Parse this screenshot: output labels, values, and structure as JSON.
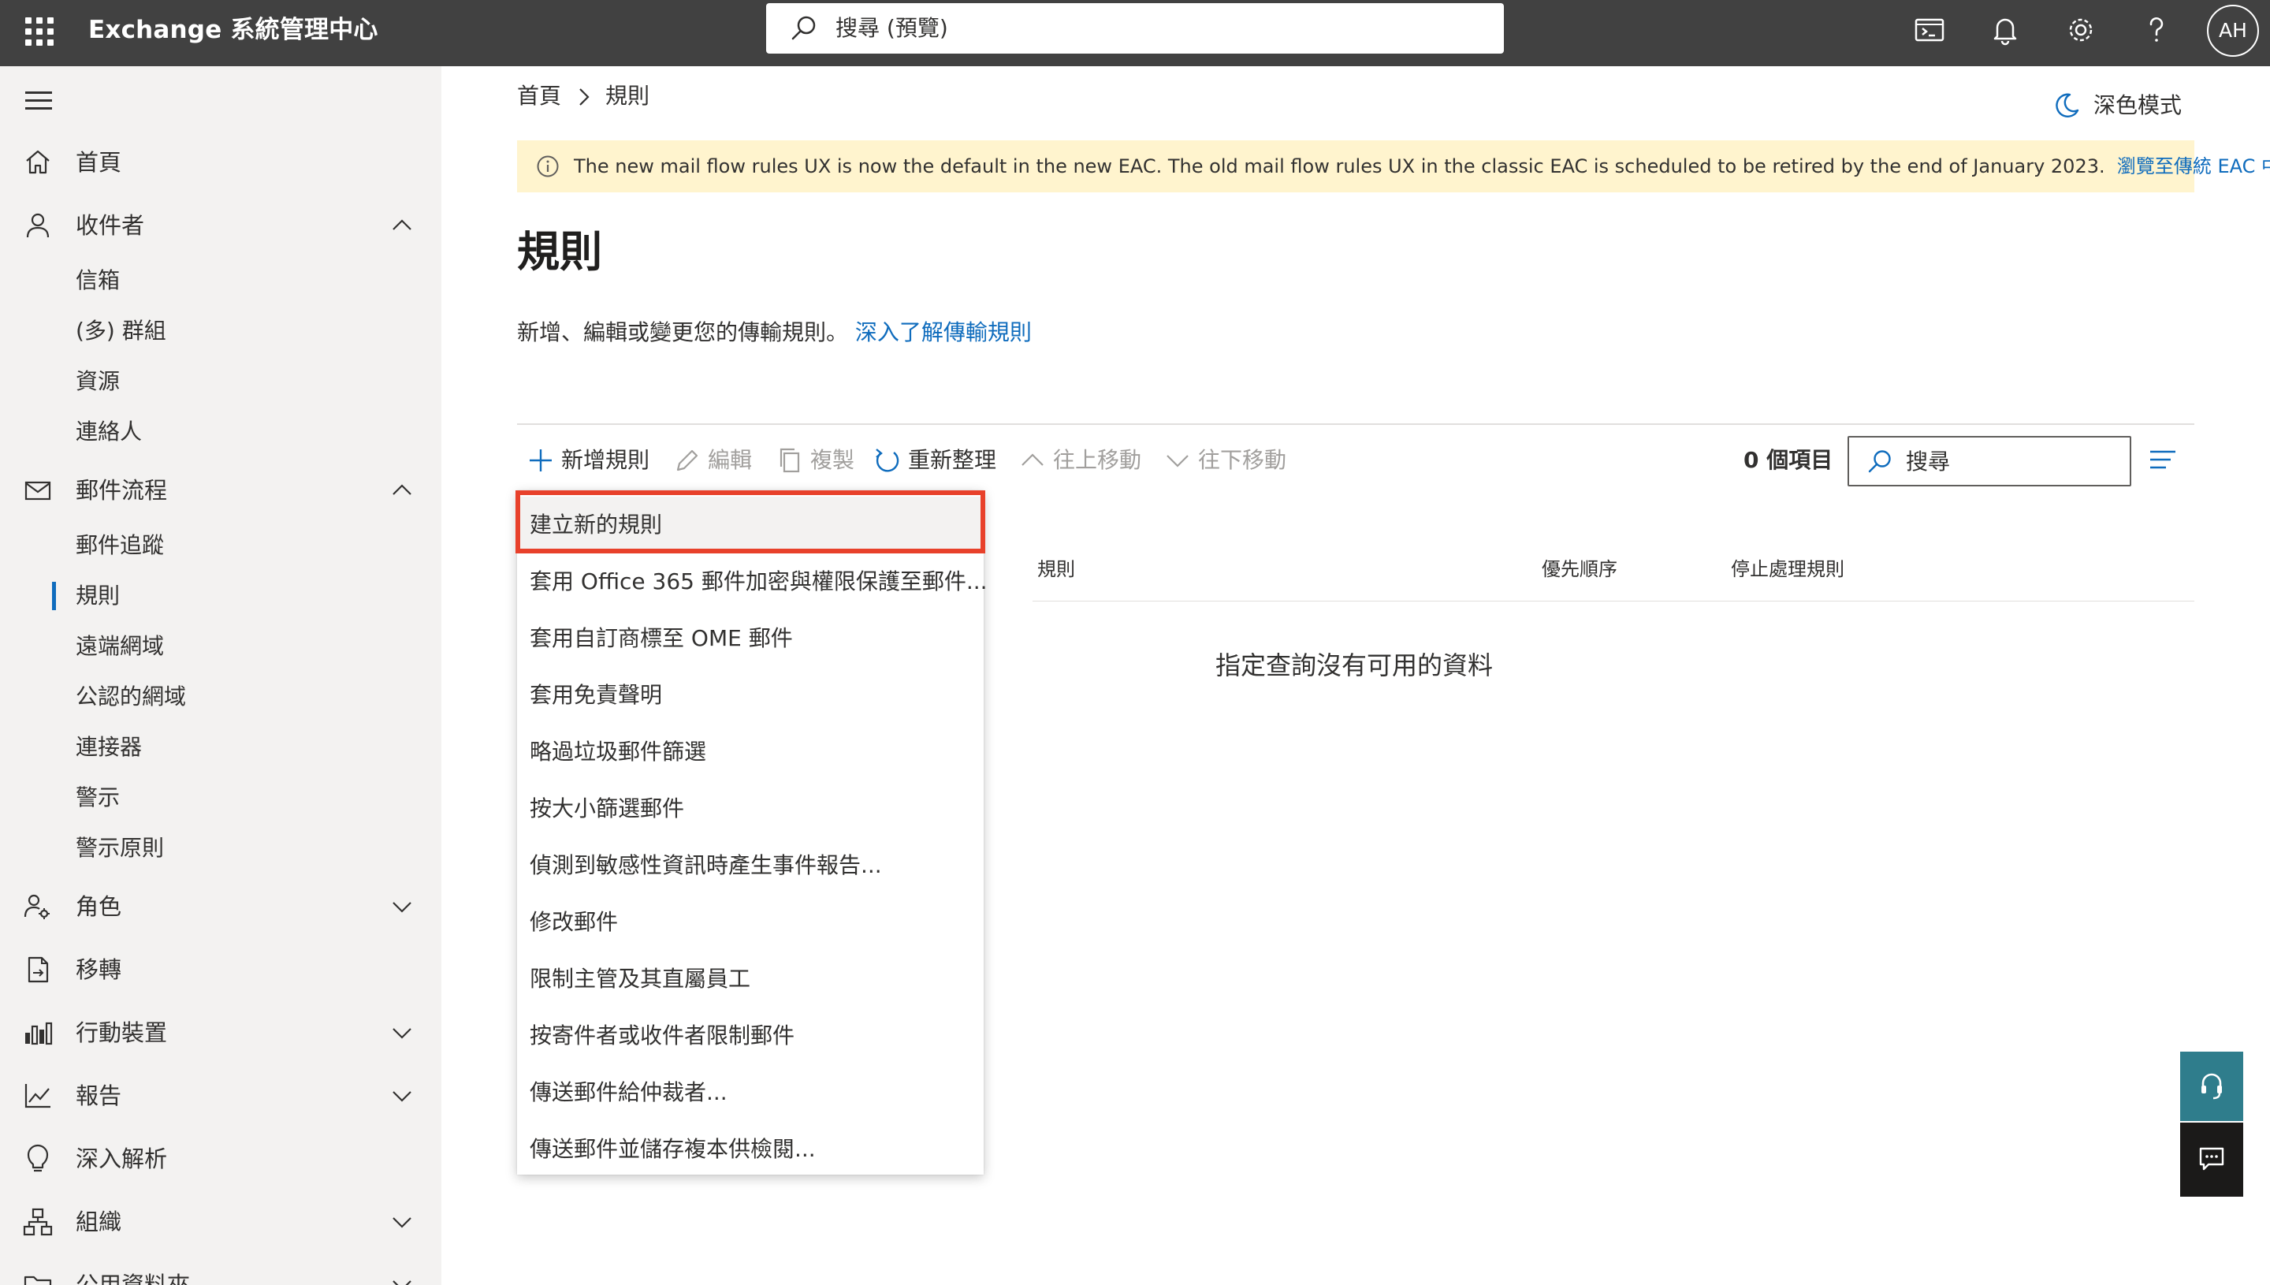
{
  "header": {
    "app_title": "Exchange 系統管理中心",
    "search_placeholder": "搜尋 (預覽)",
    "avatar_initials": "AH",
    "icons": [
      "app-launcher-icon",
      "terminal-icon",
      "bell-icon",
      "gear-icon",
      "help-icon"
    ]
  },
  "sidebar": {
    "items": [
      {
        "label": "首頁",
        "icon": "home-icon"
      },
      {
        "label": "收件者",
        "icon": "person-icon",
        "expanded": true,
        "children": [
          "信箱",
          "(多) 群組",
          "資源",
          "連絡人"
        ]
      },
      {
        "label": "郵件流程",
        "icon": "mail-icon",
        "expanded": true,
        "children": [
          "郵件追蹤",
          "規則",
          "遠端網域",
          "公認的網域",
          "連接器",
          "警示",
          "警示原則"
        ],
        "active_child": "規則"
      },
      {
        "label": "角色",
        "icon": "roles-icon",
        "expanded": false
      },
      {
        "label": "移轉",
        "icon": "migration-icon"
      },
      {
        "label": "行動裝置",
        "icon": "mobile-icon",
        "expanded": false
      },
      {
        "label": "報告",
        "icon": "chart-icon",
        "expanded": false
      },
      {
        "label": "深入解析",
        "icon": "lightbulb-icon"
      },
      {
        "label": "組織",
        "icon": "org-icon",
        "expanded": false
      },
      {
        "label": "公用資料夾",
        "icon": "folder-icon",
        "expanded": false
      }
    ]
  },
  "breadcrumb": {
    "home": "首頁",
    "current": "規則"
  },
  "dark_mode_label": "深色模式",
  "banner": {
    "message": "The new mail flow rules UX is now the default in the new EAC. The old mail flow rules UX in the classic EAC is scheduled to be retired by the end of January 2023.",
    "link": "瀏覽至傳統 EAC 中的舊版本。"
  },
  "page": {
    "title": "規則",
    "description": "新增、編輯或變更您的傳輸規則。",
    "learn_more": "深入了解傳輸規則"
  },
  "commands": {
    "add": "新增規則",
    "edit": "編輯",
    "copy": "複製",
    "refresh": "重新整理",
    "move_up": "往上移動",
    "move_down": "往下移動"
  },
  "list": {
    "item_count": "0 個項目",
    "search_placeholder": "搜尋",
    "columns": [
      "規則",
      "優先順序",
      "停止處理規則"
    ],
    "empty_message": "指定查詢沒有可用的資料"
  },
  "dropdown": {
    "items": [
      "建立新的規則",
      "套用 Office 365 郵件加密與權限保護至郵件...",
      "套用自訂商標至 OME 郵件",
      "套用免責聲明",
      "略過垃圾郵件篩選",
      "按大小篩選郵件",
      "偵測到敏感性資訊時產生事件報告...",
      "修改郵件",
      "限制主管及其直屬員工",
      "按寄件者或收件者限制郵件",
      "傳送郵件給仲裁者...",
      "傳送郵件並儲存複本供檢閱..."
    ],
    "highlighted": "建立新的規則"
  },
  "colors": {
    "topbar": "#414141",
    "accent": "#0f6cbd",
    "highlight_box": "#e8412b",
    "banner_bg": "#fff4ce",
    "help_fab": "#2f7d8c"
  }
}
